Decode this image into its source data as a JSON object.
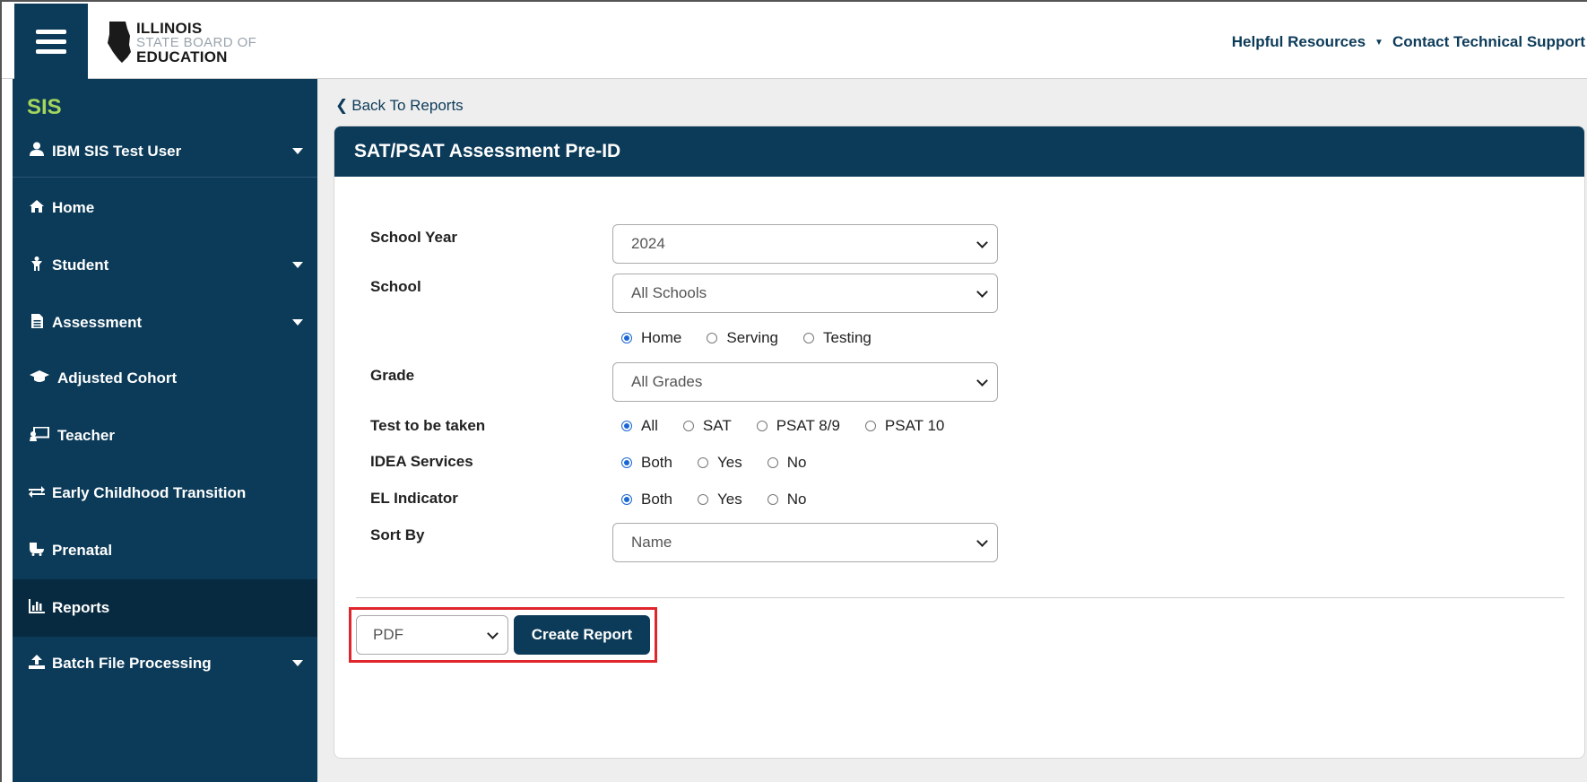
{
  "header": {
    "logo": {
      "line1": "ILLINOIS",
      "line2": "STATE BOARD OF",
      "line3": "EDUCATION"
    },
    "links": [
      "Helpful Resources",
      "Contact Technical Support"
    ]
  },
  "sidebar": {
    "title": "SIS",
    "user": "IBM SIS Test User",
    "items": [
      {
        "label": "Home",
        "icon": "home-icon",
        "expandable": false
      },
      {
        "label": "Student",
        "icon": "student-icon",
        "expandable": true
      },
      {
        "label": "Assessment",
        "icon": "document-icon",
        "expandable": true
      },
      {
        "label": "Adjusted Cohort",
        "icon": "graduation-cap-icon",
        "expandable": false
      },
      {
        "label": "Teacher",
        "icon": "teacher-board-icon",
        "expandable": false
      },
      {
        "label": "Early Childhood Transition",
        "icon": "exchange-arrows-icon",
        "expandable": false
      },
      {
        "label": "Prenatal",
        "icon": "baby-carriage-icon",
        "expandable": false
      },
      {
        "label": "Reports",
        "icon": "bar-chart-icon",
        "expandable": false,
        "active": true
      },
      {
        "label": "Batch File Processing",
        "icon": "upload-icon",
        "expandable": true
      }
    ]
  },
  "main": {
    "back_link": "Back To Reports",
    "card_title": "SAT/PSAT Assessment Pre-ID",
    "form": {
      "school_year": {
        "label": "School Year",
        "value": "2024"
      },
      "school": {
        "label": "School",
        "value": "All Schools",
        "options": [
          {
            "label": "Home",
            "checked": true
          },
          {
            "label": "Serving",
            "checked": false
          },
          {
            "label": "Testing",
            "checked": false
          }
        ]
      },
      "grade": {
        "label": "Grade",
        "value": "All Grades"
      },
      "test": {
        "label": "Test to be taken",
        "options": [
          {
            "label": "All",
            "checked": true
          },
          {
            "label": "SAT",
            "checked": false
          },
          {
            "label": "PSAT 8/9",
            "checked": false
          },
          {
            "label": "PSAT 10",
            "checked": false
          }
        ]
      },
      "idea": {
        "label": "IDEA Services",
        "options": [
          {
            "label": "Both",
            "checked": true
          },
          {
            "label": "Yes",
            "checked": false
          },
          {
            "label": "No",
            "checked": false
          }
        ]
      },
      "el": {
        "label": "EL Indicator",
        "options": [
          {
            "label": "Both",
            "checked": true
          },
          {
            "label": "Yes",
            "checked": false
          },
          {
            "label": "No",
            "checked": false
          }
        ]
      },
      "sort_by": {
        "label": "Sort By",
        "value": "Name"
      }
    },
    "footer": {
      "format": "PDF",
      "create_button": "Create Report"
    }
  },
  "colors": {
    "brand_navy": "#0c3b59",
    "sis_green": "#a3d65c",
    "highlight_red": "#e0262d",
    "radio_blue": "#1a66d4"
  }
}
